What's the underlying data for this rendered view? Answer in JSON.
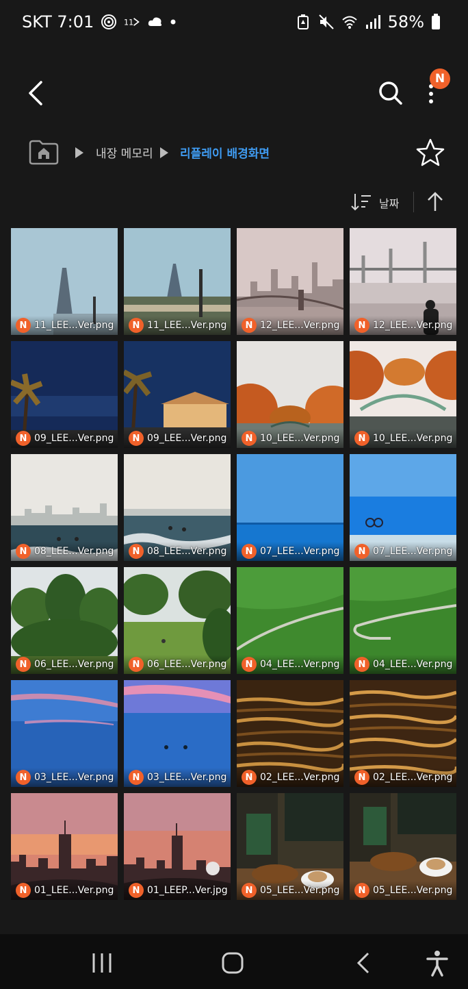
{
  "status_bar": {
    "carrier_time": "SKT 7:01",
    "battery": "58%",
    "left_icons": [
      "hotspot-icon",
      "call-forward-icon",
      "weather-icon",
      "dot-icon"
    ],
    "right_icons": [
      "battery-saver-icon",
      "mute-icon",
      "wifi-icon",
      "signal-icon",
      "battery-icon"
    ]
  },
  "app_bar": {
    "badge": "N",
    "icons": [
      "back-arrow-icon",
      "search-icon",
      "more-vert-icon"
    ]
  },
  "breadcrumb": {
    "items": [
      "내장 메모리",
      "리플레이 배경화면"
    ],
    "accent": "#3f9bf1"
  },
  "sort": {
    "label": "날짜",
    "direction": "ascending"
  },
  "grid": {
    "badge_letter": "N",
    "items": [
      {
        "name": "11_LEE...Ver.png",
        "scene": "eiffel-fog"
      },
      {
        "name": "11_LEE...Ver.png",
        "scene": "eiffel-river"
      },
      {
        "name": "12_LEE...Ver.png",
        "scene": "skyline-bridge"
      },
      {
        "name": "12_LEE...Ver.png",
        "scene": "bridge-person"
      },
      {
        "name": "09_LEE...Ver.png",
        "scene": "palm-night"
      },
      {
        "name": "09_LEE...Ver.png",
        "scene": "palm-house"
      },
      {
        "name": "10_LEE...Ver.png",
        "scene": "autumn-canal"
      },
      {
        "name": "10_LEE...Ver.png",
        "scene": "autumn-bridge"
      },
      {
        "name": "08_LEE...Ver.png",
        "scene": "surf-city"
      },
      {
        "name": "08_LEE...Ver.png",
        "scene": "surf-waves"
      },
      {
        "name": "07_LEE...Ver.png",
        "scene": "blue-sea"
      },
      {
        "name": "07_LEE...Ver.png",
        "scene": "blue-beach"
      },
      {
        "name": "06_LEE...Ver.png",
        "scene": "park-trees"
      },
      {
        "name": "06_LEE...Ver.png",
        "scene": "park-lawn"
      },
      {
        "name": "04_LEE...Ver.png",
        "scene": "green-hill"
      },
      {
        "name": "04_LEE...Ver.png",
        "scene": "green-path"
      },
      {
        "name": "03_LEE...Ver.png",
        "scene": "dusk-sea"
      },
      {
        "name": "03_LEE...Ver.png",
        "scene": "dusk-swimmers"
      },
      {
        "name": "02_LEE...Ver.png",
        "scene": "golden-water"
      },
      {
        "name": "02_LEE...Ver.png",
        "scene": "golden-water-2"
      },
      {
        "name": "01_LEE...Ver.png",
        "scene": "sunset-city"
      },
      {
        "name": "01_LEEP...Ver.jpg",
        "scene": "sunset-crowd"
      },
      {
        "name": "05_LEE...Ver.png",
        "scene": "cafe-table"
      },
      {
        "name": "05_LEE...Ver.png",
        "scene": "cafe-coffee"
      }
    ]
  },
  "nav_bar": {
    "icons": [
      "recent-apps-icon",
      "home-icon",
      "back-icon",
      "accessibility-icon"
    ]
  },
  "colors": {
    "background": "#181818",
    "badge": "#f0612a",
    "nav_background": "#0d0d0d"
  }
}
